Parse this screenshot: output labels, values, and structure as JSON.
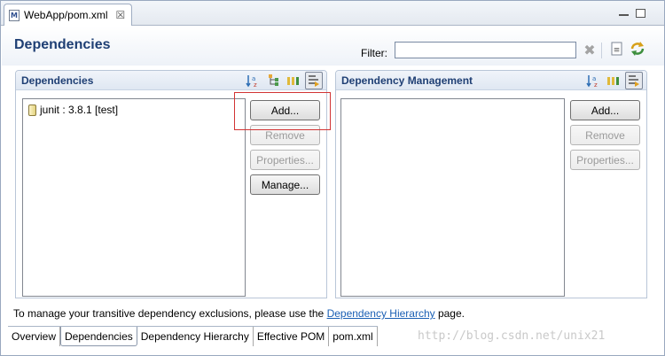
{
  "editor_tab": {
    "icon": "maven-pom-icon",
    "label": "WebApp/pom.xml",
    "close": "☒"
  },
  "header": {
    "title": "Dependencies",
    "filter_label": "Filter:",
    "filter_value": "",
    "icons": [
      "clear-filter-icon",
      "pom-icon",
      "refresh-icon"
    ]
  },
  "dependencies": {
    "title": "Dependencies",
    "toolbar_icons": [
      "sort-alpha-icon",
      "show-groupid-icon",
      "show-artifact-icon",
      "filter-toggle-icon"
    ],
    "items": [
      {
        "label": "junit : 3.8.1 [test]"
      }
    ],
    "buttons": {
      "add": "Add...",
      "remove": "Remove",
      "properties": "Properties...",
      "manage": "Manage..."
    }
  },
  "dependency_management": {
    "title": "Dependency Management",
    "toolbar_icons": [
      "sort-alpha-icon",
      "show-artifact-icon",
      "filter-toggle-icon"
    ],
    "buttons": {
      "add": "Add...",
      "remove": "Remove",
      "properties": "Properties..."
    }
  },
  "info": {
    "prefix": "To manage your transitive dependency exclusions, please use the ",
    "link": "Dependency Hierarchy",
    "suffix": " page."
  },
  "page_tabs": [
    "Overview",
    "Dependencies",
    "Dependency Hierarchy",
    "Effective POM",
    "pom.xml"
  ],
  "active_page_tab": "Dependencies",
  "watermark": "http://blog.csdn.net/unix21",
  "colors": {
    "title_blue": "#1f3f74",
    "highlight_red": "#d23434",
    "link_blue": "#1a5fb4"
  }
}
